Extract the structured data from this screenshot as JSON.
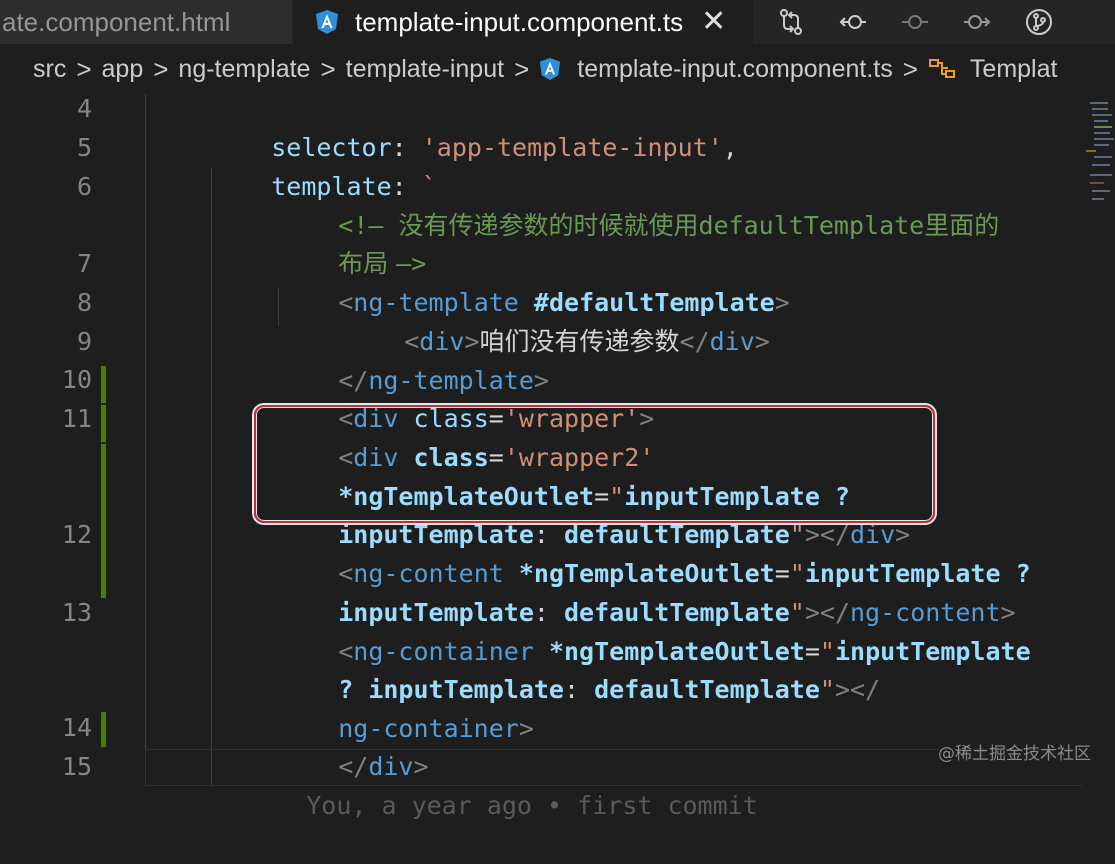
{
  "tabs": [
    {
      "label": "ate.component.html",
      "active": false
    },
    {
      "label": "template-input.component.ts",
      "active": true,
      "icon": "angular-icon",
      "close": "✕"
    }
  ],
  "breadcrumb": {
    "items": [
      "src",
      "app",
      "ng-template",
      "template-input",
      "template-input.component.ts",
      "Templat"
    ],
    "separator": ">"
  },
  "editor": {
    "line_numbers": [
      "4",
      "5",
      "6",
      "7",
      "8",
      "9",
      "10",
      "11",
      "12",
      "13",
      "14",
      "15"
    ],
    "lines": {
      "l4": {
        "a": "selector",
        "b": ": ",
        "c": "'app-template-input'",
        "d": ","
      },
      "l5": {
        "a": "template",
        "b": ": ",
        "c": "`"
      },
      "l6a": {
        "a": "<!— ",
        "b": "没有传递参数的时候就使用",
        "c": "defaultTemplate",
        "d": "里面的"
      },
      "l6b": {
        "a": "布局 ",
        "b": "—>"
      },
      "l7": {
        "a": "<",
        "b": "ng-template",
        "c": " #defaultTemplate",
        "d": ">"
      },
      "l8": {
        "a": "<",
        "b": "div",
        "c": ">",
        "d": "咱们没有传递参数",
        "e": "</",
        "f": "div",
        "g": ">"
      },
      "l9": {
        "a": "</",
        "b": "ng-template",
        "c": ">"
      },
      "l10": {
        "a": "<",
        "b": "div",
        "c": " class",
        "d": "=",
        "e": "'wrapper'",
        "f": ">"
      },
      "l11a": {
        "a": "<",
        "b": "div",
        "c": " class",
        "d": "=",
        "e": "'wrapper2'"
      },
      "l11b": {
        "a": "*ngTemplateOutlet",
        "b": "=",
        "c": "\"",
        "d": "inputTemplate ?",
        "e": ""
      },
      "l11c": {
        "a": "inputTemplate",
        "b": ": ",
        "c": "defaultTemplate",
        "d": "\"",
        "e": "></",
        "f": "div",
        "g": ">"
      },
      "l12a": {
        "a": "<",
        "b": "ng-content",
        "c": " *ngTemplateOutlet",
        "d": "=",
        "e": "\"",
        "f": "inputTemplate ?"
      },
      "l12b": {
        "a": "inputTemplate",
        "b": ": ",
        "c": "defaultTemplate",
        "d": "\"",
        "e": "></",
        "f": "ng-content",
        "g": ">"
      },
      "l13a": {
        "a": "<",
        "b": "ng-container",
        "c": " *ngTemplateOutlet",
        "d": "=",
        "e": "\"",
        "f": "inputTemplate"
      },
      "l13b": {
        "a": "? inputTemplate",
        "b": ": ",
        "c": "defaultTemplate",
        "d": "\"",
        "e": "></"
      },
      "l13c": {
        "a": "ng-container",
        "b": ">"
      },
      "l14": {
        "a": "</",
        "b": "div",
        "c": ">"
      },
      "l15": {
        "a": "You, a year ago • first commit"
      }
    }
  },
  "watermark": "@稀土掘金技术社区",
  "colors": {
    "background": "#1e1e1e",
    "property": "#9cdcfe",
    "string": "#ce9178",
    "tag": "#569cd6",
    "comment": "#6a9955",
    "git_modified": "#487e02",
    "highlight_box": "#c0303a"
  }
}
